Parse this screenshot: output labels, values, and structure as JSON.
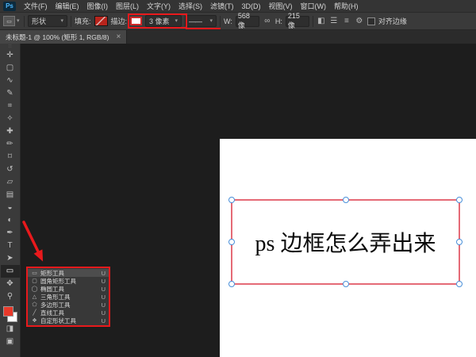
{
  "app": {
    "logo_text": "Ps"
  },
  "menubar": {
    "items": [
      "文件(F)",
      "编辑(E)",
      "图像(I)",
      "图层(L)",
      "文字(Y)",
      "选择(S)",
      "滤镜(T)",
      "3D(D)",
      "视图(V)",
      "窗口(W)",
      "帮助(H)"
    ]
  },
  "options_bar": {
    "mode": "形状",
    "fill_label": "填充:",
    "stroke_label": "描边:",
    "stroke_width": "3 像素",
    "line_style": "——",
    "w_label": "W:",
    "w_value": "568 像",
    "h_label": "H:",
    "h_value": "215 像",
    "align_edges_label": "对齐边缘",
    "caret": "▾"
  },
  "icons": {
    "preset": "▭",
    "link": "∞",
    "path_operations": "◧",
    "path_align": "☰",
    "path_arrange": "≡",
    "gear": "⚙",
    "toolbar_grip": "∷",
    "quick_mask": "◨",
    "screen_mode": "▣"
  },
  "document_tab": {
    "title": "未标题-1 @ 100% (矩形 1, RGB/8)",
    "close": "×"
  },
  "toolbar": {
    "tools": [
      {
        "name": "move",
        "glyph": "✛"
      },
      {
        "name": "marquee",
        "glyph": "▢"
      },
      {
        "name": "lasso",
        "glyph": "∿"
      },
      {
        "name": "quick-selection",
        "glyph": "✎"
      },
      {
        "name": "crop",
        "glyph": "⌗"
      },
      {
        "name": "eyedropper",
        "glyph": "✧"
      },
      {
        "name": "spot-healing",
        "glyph": "✚"
      },
      {
        "name": "brush",
        "glyph": "✏"
      },
      {
        "name": "clone-stamp",
        "glyph": "⌑"
      },
      {
        "name": "history-brush",
        "glyph": "↺"
      },
      {
        "name": "eraser",
        "glyph": "▱"
      },
      {
        "name": "gradient",
        "glyph": "▤"
      },
      {
        "name": "blur",
        "glyph": "◒"
      },
      {
        "name": "dodge",
        "glyph": "◐"
      },
      {
        "name": "pen",
        "glyph": "✒"
      },
      {
        "name": "type",
        "glyph": "T"
      },
      {
        "name": "path-selection",
        "glyph": "➤"
      },
      {
        "name": "rectangle",
        "glyph": "▭"
      },
      {
        "name": "hand",
        "glyph": "✥"
      },
      {
        "name": "zoom",
        "glyph": "⚲"
      }
    ]
  },
  "flyout": {
    "items": [
      {
        "glyph": "▭",
        "label": "矩形工具",
        "shortcut": "U"
      },
      {
        "glyph": "▢",
        "label": "圆角矩形工具",
        "shortcut": "U"
      },
      {
        "glyph": "◯",
        "label": "椭圆工具",
        "shortcut": "U"
      },
      {
        "glyph": "△",
        "label": "三角形工具",
        "shortcut": "U"
      },
      {
        "glyph": "⬠",
        "label": "多边形工具",
        "shortcut": "U"
      },
      {
        "glyph": "╱",
        "label": "直线工具",
        "shortcut": "U"
      },
      {
        "glyph": "❖",
        "label": "自定形状工具",
        "shortcut": "U"
      }
    ]
  },
  "canvas": {
    "text": "ps 边框怎么弄出来"
  },
  "colors": {
    "annotation_red": "#e8191c",
    "shape_stroke_pink": "#e56a76",
    "handle_blue": "#4a90d9",
    "foreground_swatch_red": "#e8392a",
    "panel_gray": "#3a3a3a",
    "canvas_bg": "#1d1d1d"
  }
}
